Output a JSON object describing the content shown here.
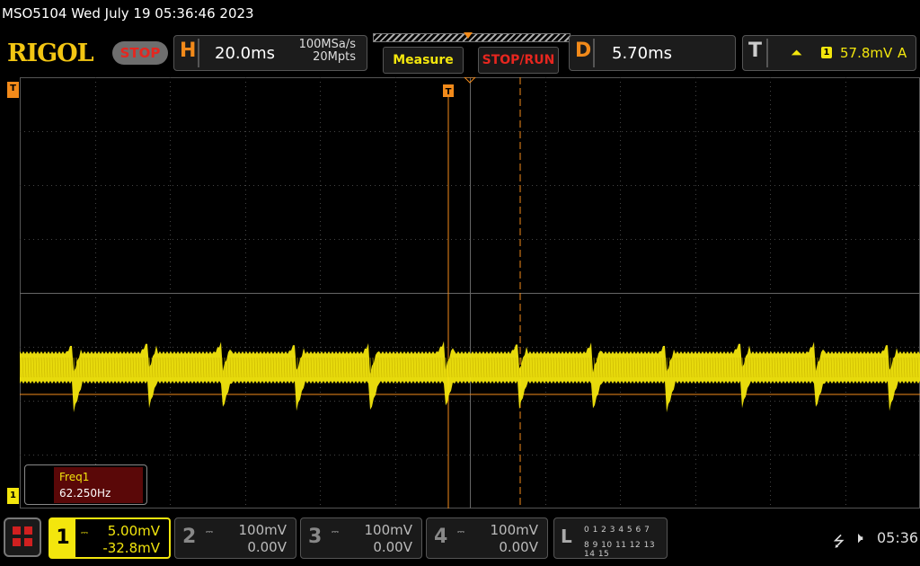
{
  "topline": {
    "text": "MSO5104  Wed July 19 05:36:46 2023"
  },
  "header": {
    "logo": "RIGOL",
    "run_state": "STOP",
    "horizontal": {
      "letter": "H",
      "timebase": "20.0ms",
      "sample_rate": "100MSa/s",
      "memory_depth": "20Mpts"
    },
    "measure_label": "Measure",
    "stop_run_label": "STOP/RUN",
    "delay": {
      "letter": "D",
      "value": "5.70ms"
    },
    "trigger": {
      "letter": "T",
      "edge_icon": "rising-edge-icon",
      "source": "1",
      "level": "57.8mV",
      "mode": "A"
    }
  },
  "markers": {
    "trigger_tag": "T",
    "ch1_tag": "1"
  },
  "measurement": {
    "label": "Freq1",
    "value": "62.250Hz"
  },
  "channels": [
    {
      "num": "1",
      "scale": "5.00mV",
      "offset": "-32.8mV",
      "active": true,
      "color": "#f3e60d"
    },
    {
      "num": "2",
      "scale": "100mV",
      "offset": "0.00V",
      "active": false
    },
    {
      "num": "3",
      "scale": "100mV",
      "offset": "0.00V",
      "active": false
    },
    {
      "num": "4",
      "scale": "100mV",
      "offset": "0.00V",
      "active": false
    }
  ],
  "logic": {
    "letter": "L",
    "row1": "0 1 2 3   4 5 6 7",
    "row2": "8 9 10 11 12 13 14 15"
  },
  "status": {
    "clock": "05:36",
    "usb_icon": "usb-icon",
    "sound_icon": "mute-icon"
  },
  "colors": {
    "ch1": "#f3e60d",
    "trigger": "#f28a1a",
    "stop": "#e6261f",
    "measure_bg": "#5a0808"
  }
}
